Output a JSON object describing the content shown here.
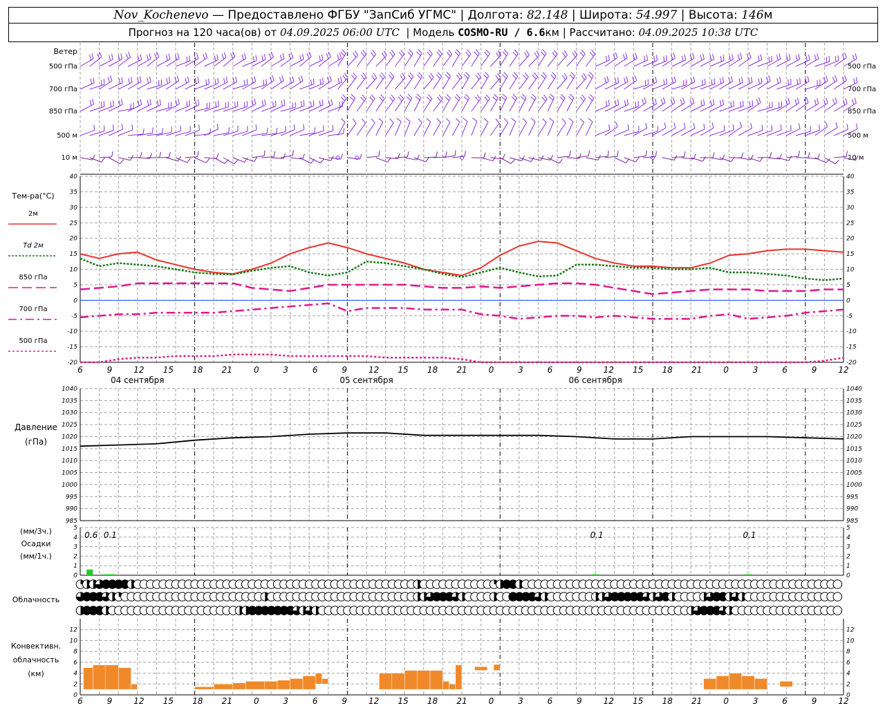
{
  "header": {
    "station": "Nov_Kochenevo",
    "provider": "— Предоставлено ФГБУ \"ЗапСиб УГМС\"",
    "lon_label": "Долгота:",
    "lon_value": "82.148",
    "lat_label": "Широта:",
    "lat_value": "54.997",
    "alt_label": "Высота:",
    "alt_value": "146",
    "alt_unit": "м",
    "forecast_label": "Прогноз на 120 часа(ов) от",
    "forecast_start": "04.09.2025 06:00 UTC",
    "model_label": "Модель",
    "model_name": "COSMO-RU / 6.6",
    "model_unit": "км",
    "calc_label": "Рассчитано:",
    "calc_time": "04.09.2025 10:38 UTC"
  },
  "wind_panel": {
    "title": "Ветер",
    "levels": [
      "500 гПа",
      "700 гПа",
      "850 гПа",
      "500 м",
      "10  м"
    ],
    "right_levels": [
      "500 гПа",
      "700 гПа",
      "850 гПа",
      "500 м",
      "10  м"
    ],
    "barb_color": "#8a2be2",
    "low_level_color": "#7b1fa2"
  },
  "colors": {
    "t2m": "#e8322a",
    "td2m": "#1a7a1a",
    "t850": "#e0168c",
    "t700": "#e0168c",
    "t500": "#e0168c",
    "zero_line": "#2040ff",
    "pressure": "#000000",
    "precip": "#22cc22",
    "convective": "#f0892a",
    "grid": "#a0a0a0"
  },
  "chart_data": [
    {
      "type": "line",
      "title": "Тем-ра(°C)",
      "ylim": [
        -20,
        40
      ],
      "yticks": [
        -20,
        -15,
        -10,
        -5,
        0,
        5,
        10,
        15,
        20,
        25,
        30,
        35,
        40
      ],
      "time_hours": [
        0,
        3,
        6,
        9,
        12,
        15,
        18,
        21,
        24,
        27,
        30,
        33,
        36,
        39,
        42,
        45,
        48,
        51,
        54,
        57,
        60,
        63,
        66,
        69,
        72,
        75,
        78,
        81,
        84,
        87,
        90,
        93,
        96,
        99,
        102,
        105,
        108,
        111,
        114,
        117,
        120
      ],
      "series": [
        {
          "name": "2м",
          "values": [
            15,
            13.5,
            15,
            15.5,
            13,
            11.5,
            10,
            9,
            8.5,
            10,
            12,
            15,
            17,
            18.5,
            17,
            15,
            13.5,
            12,
            10,
            9,
            8,
            10.5,
            14.5,
            17.5,
            19,
            18.5,
            16,
            13.5,
            12,
            11,
            11,
            10.5,
            10.5,
            12,
            14.5,
            15,
            16,
            16.5,
            16.5,
            16,
            15.5
          ]
        },
        {
          "name": "Td  2м",
          "values": [
            13.5,
            11,
            12,
            11.5,
            11,
            10,
            9,
            8.5,
            8.3,
            9.5,
            10.5,
            11,
            9,
            8,
            9,
            12.5,
            12,
            11,
            10,
            8.5,
            7.5,
            9,
            10.5,
            9,
            7.7,
            8,
            11.5,
            11.5,
            11,
            10.5,
            10.5,
            10,
            10,
            10.5,
            9,
            9,
            8.5,
            8,
            7,
            6.5,
            7
          ]
        },
        {
          "name": "850 гПа",
          "values": [
            3.5,
            4,
            4.5,
            5.5,
            5.5,
            5.5,
            5.5,
            5.5,
            5.5,
            4,
            3.5,
            3,
            4,
            5,
            5,
            5,
            5,
            5,
            4.5,
            4,
            4,
            4.5,
            4,
            4.5,
            5,
            5.5,
            5.5,
            5,
            4,
            3,
            2,
            2.5,
            3,
            3.5,
            3.5,
            3.5,
            3,
            3,
            3,
            3.5,
            3.5
          ]
        },
        {
          "name": "700 гПа",
          "values": [
            -5.5,
            -5,
            -4.5,
            -4.5,
            -4,
            -4,
            -4,
            -4,
            -3.5,
            -3,
            -2.5,
            -2,
            -1.5,
            -1,
            -3.5,
            -2.5,
            -2.5,
            -2.5,
            -3,
            -3,
            -3,
            -4.5,
            -5,
            -6,
            -5.5,
            -5,
            -5,
            -5.5,
            -5,
            -5.5,
            -6,
            -6,
            -6,
            -5,
            -4.5,
            -6,
            -5.5,
            -5,
            -4,
            -3.5,
            -3
          ]
        },
        {
          "name": "500 гПа",
          "values": [
            -21,
            -20.5,
            -19,
            -18.5,
            -18.5,
            -18,
            -18,
            -18,
            -17.5,
            -17.5,
            -17.5,
            -18,
            -18,
            -18,
            -18,
            -18,
            -18.5,
            -18.5,
            -18.5,
            -18.5,
            -19,
            -20,
            -21,
            -21.5,
            -21.5,
            -21.5,
            -21.5,
            -21.5,
            -21.5,
            -21.5,
            -21.5,
            -21.5,
            -21.5,
            -21.5,
            -21.5,
            -21.5,
            -21.5,
            -21,
            -20.5,
            -19.5,
            -18.5
          ]
        }
      ]
    },
    {
      "type": "line",
      "title": "Давление",
      "unit": "(гПа)",
      "ylim": [
        985,
        1040
      ],
      "yticks": [
        985,
        990,
        995,
        1000,
        1005,
        1010,
        1015,
        1020,
        1025,
        1030,
        1035,
        1040
      ],
      "time_hours": [
        0,
        6,
        12,
        18,
        24,
        30,
        36,
        42,
        48,
        54,
        60,
        66,
        72,
        78,
        84,
        90,
        96,
        102,
        108,
        114,
        120
      ],
      "values": [
        1016,
        1016.5,
        1017,
        1018.5,
        1019.5,
        1020,
        1021,
        1021.5,
        1021.5,
        1020.5,
        1020.5,
        1020.5,
        1020.5,
        1020,
        1019,
        1019,
        1020,
        1020,
        1020,
        1019.5,
        1019
      ]
    },
    {
      "type": "bar",
      "title": "Осадки",
      "left_units": [
        "(мм/3ч.)",
        "(мм/1ч.)"
      ],
      "ylim": [
        0,
        5
      ],
      "yticks": [
        0,
        1,
        2,
        3,
        4,
        5
      ],
      "bars": [
        {
          "hour": 1.5,
          "width_hours": 1,
          "value": 0.6,
          "label": "0.6"
        },
        {
          "hour": 4.5,
          "width_hours": 2,
          "value": 0.1,
          "label": "0.1"
        },
        {
          "hour": 81,
          "width_hours": 1,
          "value": 0.1,
          "label": "0.1"
        },
        {
          "hour": 105,
          "width_hours": 1,
          "value": 0.1,
          "label": "0.1"
        }
      ]
    },
    {
      "type": "table",
      "title": "Облачность",
      "rows": 3,
      "legend": "0 = clear, 1 = quarter, 2 = half, 3 = three-quarter, 4 = overcast",
      "cells": [
        [
          1,
          2,
          2,
          3,
          4,
          4,
          4,
          4,
          2,
          0,
          0,
          0,
          0,
          0,
          0,
          0,
          0,
          0,
          0,
          0,
          0,
          0,
          0,
          0,
          0,
          0,
          0,
          0,
          0,
          0,
          0,
          0,
          0,
          0,
          0,
          0,
          0,
          0,
          0,
          0,
          0,
          0,
          0,
          0,
          0,
          0,
          0,
          0,
          0,
          0,
          0,
          0,
          0,
          2,
          0,
          0,
          0,
          0,
          0,
          0,
          0,
          0,
          0,
          0,
          0,
          1,
          2,
          4,
          4,
          2,
          0,
          0,
          0,
          0,
          0,
          0,
          0,
          0,
          0,
          0,
          0,
          0,
          0,
          0,
          0,
          0,
          0,
          0,
          0,
          0,
          0,
          0,
          0,
          0,
          0,
          0,
          0,
          0,
          0,
          0,
          0,
          0,
          0,
          0,
          0,
          0,
          0,
          0,
          0,
          0,
          0,
          0,
          0,
          0,
          0,
          0,
          0,
          0,
          0,
          0
        ],
        [
          3,
          4,
          4,
          4,
          3,
          2,
          1,
          0,
          0,
          0,
          0,
          0,
          0,
          0,
          0,
          0,
          0,
          0,
          0,
          0,
          0,
          0,
          0,
          0,
          0,
          0,
          0,
          0,
          0,
          2,
          0,
          0,
          0,
          0,
          0,
          0,
          0,
          0,
          0,
          0,
          0,
          0,
          0,
          0,
          0,
          0,
          0,
          0,
          0,
          0,
          0,
          0,
          0,
          2,
          2,
          3,
          4,
          4,
          4,
          3,
          2,
          0,
          0,
          0,
          0,
          2,
          0,
          0,
          4,
          4,
          4,
          4,
          3,
          2,
          0,
          0,
          0,
          0,
          0,
          0,
          0,
          2,
          2,
          3,
          4,
          4,
          4,
          4,
          4,
          3,
          2,
          3,
          4,
          2,
          0,
          0,
          0,
          0,
          2,
          3,
          4,
          4,
          2,
          3,
          2,
          0,
          0,
          0,
          0,
          0,
          0,
          0,
          0,
          0,
          0,
          0,
          0,
          0,
          0,
          0
        ],
        [
          2,
          4,
          4,
          4,
          2,
          0,
          0,
          0,
          0,
          0,
          0,
          0,
          0,
          0,
          0,
          0,
          0,
          0,
          0,
          0,
          0,
          0,
          0,
          0,
          0,
          2,
          2,
          4,
          4,
          4,
          4,
          4,
          4,
          4,
          3,
          2,
          3,
          2,
          0,
          0,
          0,
          0,
          0,
          0,
          0,
          0,
          0,
          0,
          0,
          0,
          0,
          0,
          0,
          0,
          0,
          0,
          0,
          0,
          0,
          0,
          0,
          0,
          0,
          0,
          0,
          0,
          0,
          0,
          0,
          0,
          0,
          0,
          0,
          0,
          0,
          0,
          0,
          0,
          0,
          0,
          0,
          0,
          0,
          0,
          0,
          0,
          0,
          0,
          0,
          0,
          0,
          0,
          0,
          0,
          0,
          0,
          2,
          3,
          4,
          4,
          4,
          3,
          2,
          0,
          0,
          0,
          0,
          0,
          0,
          0,
          0,
          0,
          0,
          0,
          0,
          0,
          0,
          0,
          0,
          0
        ]
      ]
    },
    {
      "type": "bar",
      "title": "Конвективн. облачность",
      "unit": "(км)",
      "ylim": [
        0,
        14
      ],
      "yticks": [
        0,
        2,
        4,
        6,
        8,
        10,
        12
      ],
      "bars": [
        {
          "start": 0.5,
          "end": 2,
          "base": 1,
          "top": 5
        },
        {
          "start": 2,
          "end": 4,
          "base": 1,
          "top": 5.5
        },
        {
          "start": 4,
          "end": 6,
          "base": 1,
          "top": 5.5
        },
        {
          "start": 6,
          "end": 8,
          "base": 1,
          "top": 5
        },
        {
          "start": 8,
          "end": 9,
          "base": 1,
          "top": 2
        },
        {
          "start": 18,
          "end": 21,
          "base": 1,
          "top": 1.5
        },
        {
          "start": 21,
          "end": 24,
          "base": 1,
          "top": 2
        },
        {
          "start": 24,
          "end": 26,
          "base": 1,
          "top": 2.2
        },
        {
          "start": 26,
          "end": 29,
          "base": 1,
          "top": 2.5
        },
        {
          "start": 29,
          "end": 31,
          "base": 1,
          "top": 2.5
        },
        {
          "start": 31,
          "end": 33,
          "base": 1,
          "top": 2.7
        },
        {
          "start": 33,
          "end": 35,
          "base": 1,
          "top": 3
        },
        {
          "start": 35,
          "end": 37,
          "base": 1,
          "top": 3.5
        },
        {
          "start": 37,
          "end": 38,
          "base": 2,
          "top": 4
        },
        {
          "start": 38,
          "end": 39,
          "base": 2,
          "top": 3
        },
        {
          "start": 47,
          "end": 49,
          "base": 1,
          "top": 4
        },
        {
          "start": 49,
          "end": 51,
          "base": 1,
          "top": 4
        },
        {
          "start": 51,
          "end": 53,
          "base": 1,
          "top": 4.5
        },
        {
          "start": 53,
          "end": 55,
          "base": 1,
          "top": 4.5
        },
        {
          "start": 55,
          "end": 57,
          "base": 1,
          "top": 4.5
        },
        {
          "start": 57,
          "end": 58,
          "base": 1,
          "top": 2.5
        },
        {
          "start": 58,
          "end": 59,
          "base": 1,
          "top": 2
        },
        {
          "start": 59,
          "end": 60,
          "base": 1,
          "top": 5.5
        },
        {
          "start": 62,
          "end": 64,
          "base": 4.5,
          "top": 5.2
        },
        {
          "start": 65,
          "end": 66,
          "base": 4.5,
          "top": 5.6
        },
        {
          "start": 98,
          "end": 100,
          "base": 1,
          "top": 3
        },
        {
          "start": 100,
          "end": 102,
          "base": 1,
          "top": 3.5
        },
        {
          "start": 102,
          "end": 104,
          "base": 1,
          "top": 4
        },
        {
          "start": 104,
          "end": 106,
          "base": 1,
          "top": 3.5
        },
        {
          "start": 106,
          "end": 108,
          "base": 1,
          "top": 3
        },
        {
          "start": 110,
          "end": 112,
          "base": 1.5,
          "top": 2.5
        }
      ]
    }
  ],
  "time_axis": {
    "start_hour_utc": 6,
    "tick_labels": [
      "6",
      "9",
      "12",
      "15",
      "18",
      "21",
      "0",
      "3",
      "6",
      "9",
      "12",
      "15",
      "18",
      "21",
      "0",
      "3",
      "6",
      "9",
      "12",
      "15",
      "18",
      "21",
      "0",
      "3",
      "6",
      "9",
      "12"
    ],
    "day_labels": [
      "04 сентября",
      "05 сентября",
      "06 сентября"
    ]
  }
}
